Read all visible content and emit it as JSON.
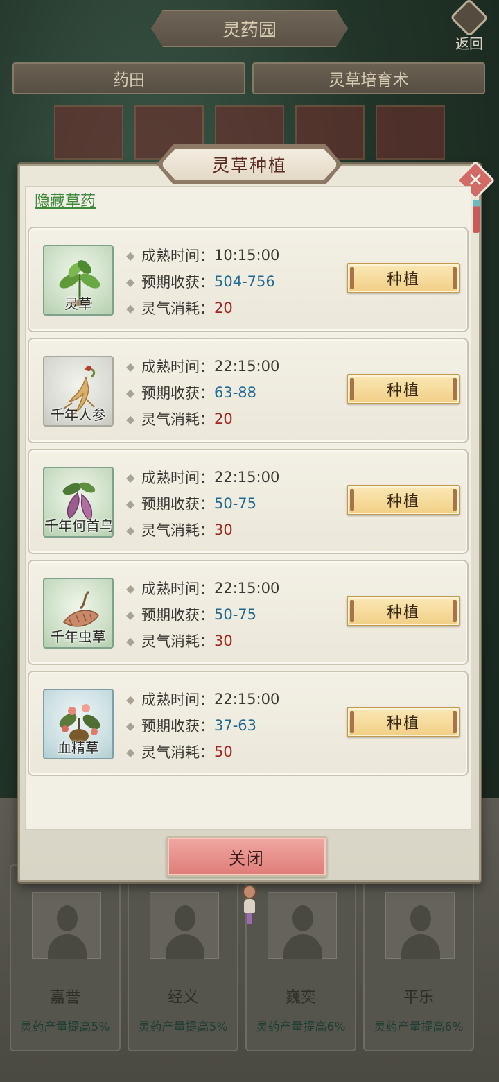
{
  "background": {
    "title": "灵药园",
    "back_label": "返回",
    "tabs": [
      "药田",
      "灵草培育术"
    ],
    "cards": [
      {
        "name": "嘉誉",
        "bonus": "灵药产量提高5%"
      },
      {
        "name": "经义",
        "bonus": "灵药产量提高5%"
      },
      {
        "name": "巍奕",
        "bonus": "灵药产量提高6%"
      },
      {
        "name": "平乐",
        "bonus": "灵药产量提高6%"
      }
    ]
  },
  "dialog": {
    "title": "灵草种植",
    "hidden_link": "隐藏草药",
    "labels": {
      "mature": "成熟时间：",
      "harvest": "预期收获：",
      "cost": "灵气消耗："
    },
    "plant_label": "种植",
    "close_label": "关闭",
    "herbs": [
      {
        "name": "灵草",
        "mature": "10:15:00",
        "harvest": "504-756",
        "cost": "20",
        "icon": "sprout-icon"
      },
      {
        "name": "千年人参",
        "mature": "22:15:00",
        "harvest": "63-88",
        "cost": "20",
        "icon": "ginseng-icon"
      },
      {
        "name": "千年何首乌",
        "mature": "22:15:00",
        "harvest": "50-75",
        "cost": "30",
        "icon": "fleeceflower-root-icon"
      },
      {
        "name": "千年虫草",
        "mature": "22:15:00",
        "harvest": "50-75",
        "cost": "30",
        "icon": "cordyceps-icon"
      },
      {
        "name": "血精草",
        "mature": "22:15:00",
        "harvest": "37-63",
        "cost": "50",
        "icon": "blood-herb-icon"
      }
    ]
  },
  "colors": {
    "harvest_value": "#1f6a94",
    "cost_value": "#a4231d",
    "link": "#3f8a3c",
    "plant_button": "#f1cf85",
    "close_button": "#df7c78"
  }
}
